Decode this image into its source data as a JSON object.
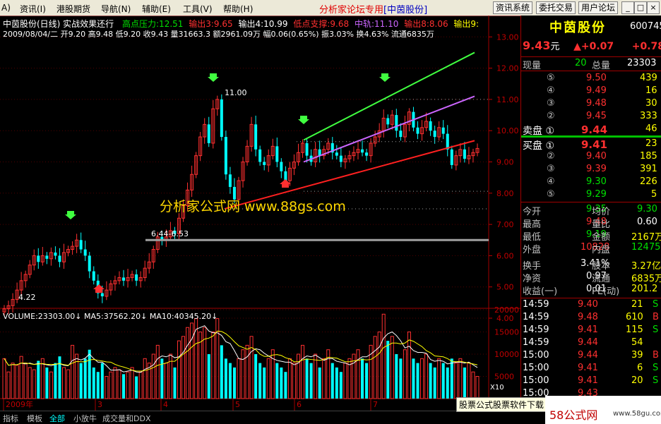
{
  "menu": {
    "items": [
      "资讯(I)",
      "港股期货",
      "导航(N)",
      "辅助(E)",
      "工具(V)",
      "帮助(H)"
    ],
    "center_title": "分析家论坛专用",
    "center_stock": "[中茵股份]",
    "right_buttons": [
      "资讯系统",
      "委托交易",
      "用户论坛"
    ],
    "window_controls": [
      "_",
      "□",
      "×"
    ]
  },
  "chart_info": {
    "line1_name": "中茵股份(日线) 实战效果还行",
    "line1_high": "高点压力:12.51",
    "line1_out3": "输出3:9.65",
    "line1_out4": "输出4:10.99",
    "line1_low": "低点支撑:9.68",
    "line1_mid": "中轨:11.10",
    "line1_out8": "输出8:8.06",
    "line1_out9": "输出9:",
    "line2": "2009/08/04/二  开9.20  高9.48  低9.20  收9.43  量31663.3  额2961.09万  幅0.06(0.65%)  振3.03%  换4.63%  流通6835万",
    "watermark": "分析家公式网 www.88gs.com",
    "annotations": {
      "peak": "11.00",
      "low_range": "6.44-6.53",
      "bottom": "4.22"
    },
    "price_axis": [
      "13.00",
      "12.00",
      "11.00",
      "10.00",
      "9.00",
      "8.00",
      "7.00",
      "6.00",
      "5.00",
      "4.00"
    ],
    "volume_axis": [
      "20000",
      "15000",
      "10000",
      "5000"
    ],
    "volume_unit": "X10",
    "volume_info": "VOLUME:23303.00↓  MA5:37562.20↓  MA10:40345.20↓",
    "month_labels": [
      "2009年",
      "3",
      "4",
      "5",
      "6",
      "7"
    ]
  },
  "panel": {
    "name": "中茵股份",
    "code": "600745",
    "price": "9.43",
    "price_unit": "元",
    "change": "+0.07",
    "change_pct": "+0.78",
    "current_vol_label": "现量",
    "current_vol": "20",
    "total_vol_label": "总量",
    "total_vol": "23303",
    "sell": [
      {
        "lvl": "⑤",
        "p": "9.50",
        "v": "439"
      },
      {
        "lvl": "④",
        "p": "9.49",
        "v": "16"
      },
      {
        "lvl": "③",
        "p": "9.48",
        "v": "30"
      },
      {
        "lvl": "②",
        "p": "9.45",
        "v": "333"
      },
      {
        "lvl": "卖盘 ①",
        "p": "9.44",
        "v": "46"
      }
    ],
    "buy": [
      {
        "lvl": "买盘 ①",
        "p": "9.41",
        "v": "23"
      },
      {
        "lvl": "②",
        "p": "9.40",
        "v": "185"
      },
      {
        "lvl": "③",
        "p": "9.39",
        "v": "391"
      },
      {
        "lvl": "④",
        "p": "9.30",
        "v": "226"
      },
      {
        "lvl": "⑤",
        "p": "9.29",
        "v": "5"
      }
    ],
    "stats": [
      {
        "l1": "今开",
        "v1": "9.35",
        "l2": "均价",
        "v2": "9.30"
      },
      {
        "l1": "最高",
        "v1": "9.48",
        "l2": "量比",
        "v2": "0.60"
      },
      {
        "l1": "最低",
        "v1": "9.19",
        "l2": "金额",
        "v2": "2167万"
      },
      {
        "l1": "外盘",
        "v1": "10828",
        "l2": "内盘",
        "v2": "12475"
      },
      {
        "l1": "换手",
        "v1": "3.41%",
        "l2": "股本",
        "v2": "3.27亿"
      },
      {
        "l1": "净资",
        "v1": "0.97",
        "l2": "流通",
        "v2": "6835万"
      },
      {
        "l1": "收益(一)",
        "v1": "0.01",
        "l2": "PE(动)",
        "v2": "201.2"
      }
    ],
    "ticks": [
      {
        "t": "14:59",
        "p": "9.40",
        "v": "21",
        "f": "S"
      },
      {
        "t": "14:59",
        "p": "9.48",
        "v": "610",
        "f": "B"
      },
      {
        "t": "14:59",
        "p": "9.41",
        "v": "115",
        "f": "S"
      },
      {
        "t": "14:59",
        "p": "9.44",
        "v": "54",
        "f": ""
      },
      {
        "t": "15:00",
        "p": "9.44",
        "v": "39",
        "f": "B"
      },
      {
        "t": "15:00",
        "p": "9.41",
        "v": "6",
        "f": "S"
      },
      {
        "t": "15:00",
        "p": "9.41",
        "v": "20",
        "f": "S"
      },
      {
        "t": "15:00",
        "p": "9.43",
        "v": "",
        "f": ""
      }
    ]
  },
  "tabs": [
    "指标",
    "模板",
    "全部",
    "小放牛",
    "成交量和DDX"
  ],
  "ad_text": "股票公式股票软件下载",
  "logo_text": "58公式网",
  "logo_url": "www.58gu.com",
  "colors": {
    "up": "#ff3030",
    "down": "#00ffff",
    "green_line": "#40ff40",
    "purple_line": "#cc66ff",
    "red_line": "#ff2020"
  }
}
